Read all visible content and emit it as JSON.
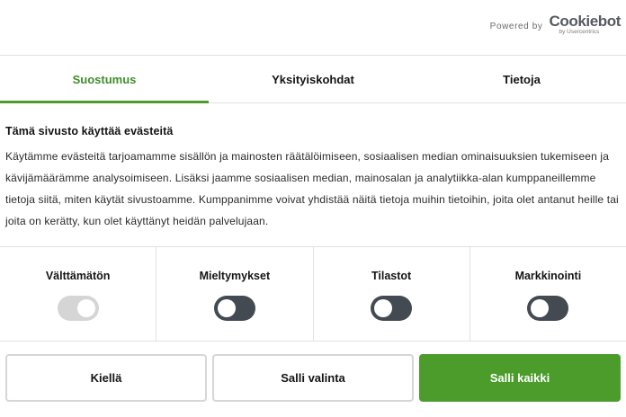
{
  "branding": {
    "powered_by": "Powered by",
    "logo_name": "Cookiebot",
    "logo_sub": "by Usercentrics"
  },
  "tabs": [
    {
      "label": "Suostumus",
      "active": true
    },
    {
      "label": "Yksityiskohdat",
      "active": false
    },
    {
      "label": "Tietoja",
      "active": false
    }
  ],
  "content": {
    "heading": "Tämä sivusto käyttää evästeitä",
    "body": "Käytämme evästeitä tarjoamamme sisällön ja mainosten räätälöimiseen, sosiaalisen median ominaisuuksien tukemiseen ja kävijämäärämme analysoimiseen. Lisäksi jaamme sosiaalisen median, mainosalan ja analytiikka-alan kumppaneillemme tietoja siitä, miten käytät sivustoamme. Kumppanimme voivat yhdistää näitä tietoja muihin tietoihin, joita olet antanut heille tai joita on kerätty, kun olet käyttänyt heidän palvelujaan."
  },
  "toggles": [
    {
      "label": "Välttämätön",
      "enabled": true,
      "disabled": true
    },
    {
      "label": "Mieltymykset",
      "enabled": false,
      "disabled": false
    },
    {
      "label": "Tilastot",
      "enabled": false,
      "disabled": false
    },
    {
      "label": "Markkinointi",
      "enabled": false,
      "disabled": false
    }
  ],
  "buttons": {
    "deny": "Kiellä",
    "allow_selection": "Salli valinta",
    "allow_all": "Salli kaikki"
  },
  "colors": {
    "accent": "#4b9c2b",
    "toggle_off": "#434a52",
    "toggle_disabled": "#d5d5d5"
  }
}
